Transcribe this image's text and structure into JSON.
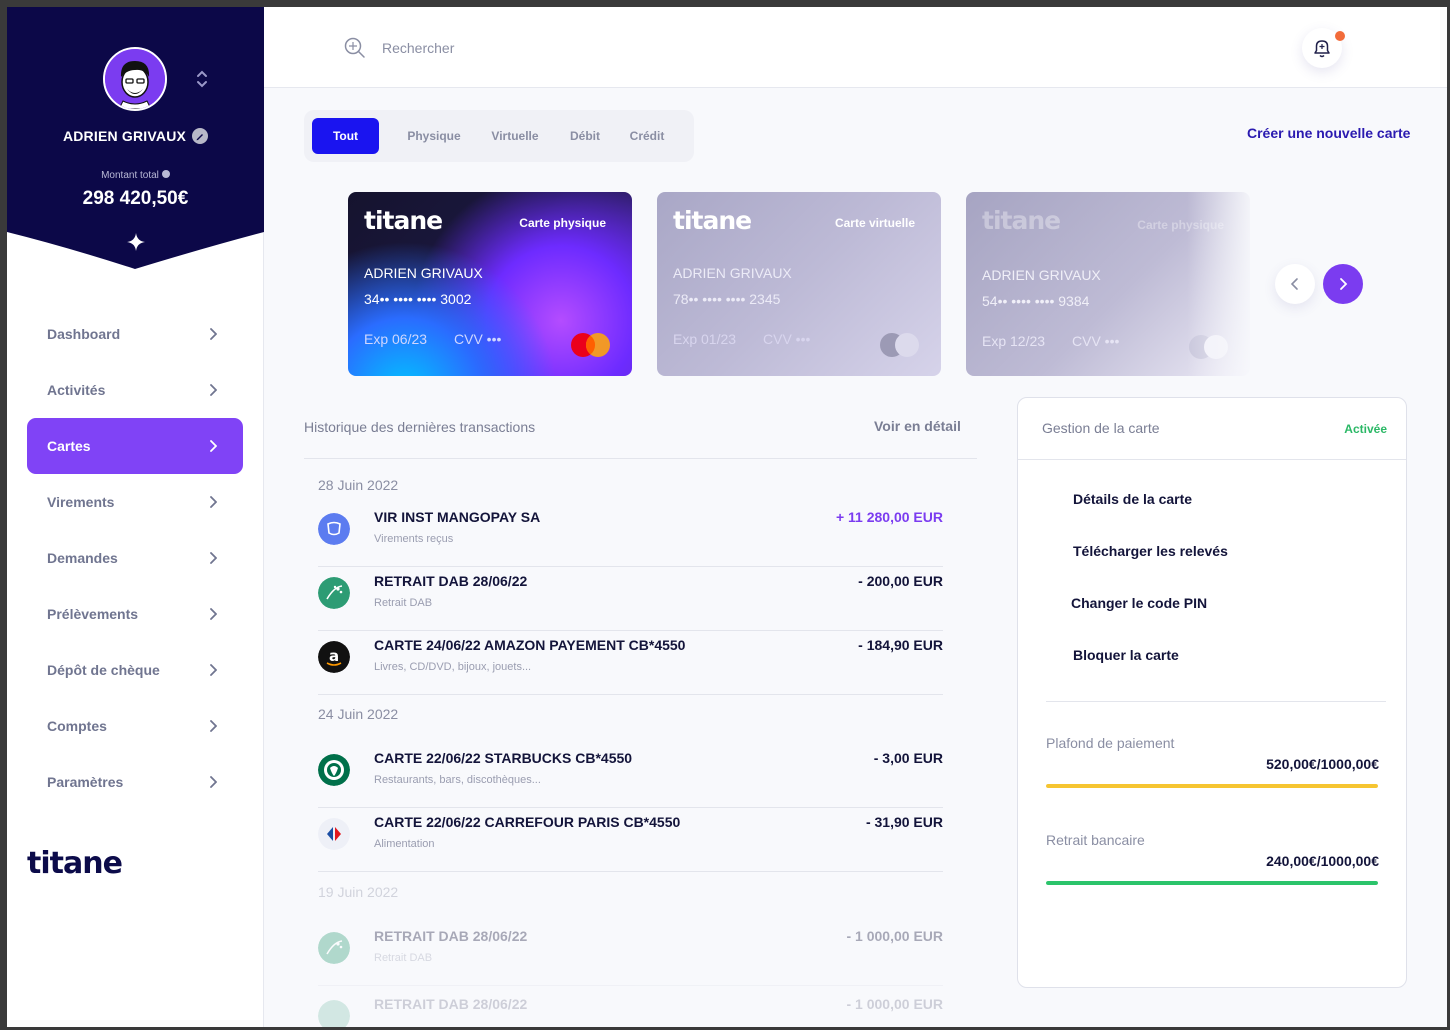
{
  "sidebar": {
    "user_name": "ADRIEN GRIVAUX",
    "total_label": "Montant total",
    "total_amount": "298 420,50€",
    "brand": "titane",
    "nav": [
      {
        "label": "Dashboard",
        "active": false
      },
      {
        "label": "Activités",
        "active": false
      },
      {
        "label": "Cartes",
        "active": true
      },
      {
        "label": "Virements",
        "active": false
      },
      {
        "label": "Demandes",
        "active": false
      },
      {
        "label": "Prélèvements",
        "active": false
      },
      {
        "label": "Dépôt de chèque",
        "active": false
      },
      {
        "label": "Comptes",
        "active": false
      },
      {
        "label": "Paramètres",
        "active": false
      }
    ],
    "colors": {
      "header_bg": "#0c0848",
      "active_bg": "#8043f6"
    }
  },
  "topbar": {
    "search_placeholder": "Rechercher",
    "notification_dot": true
  },
  "filters": {
    "tabs": [
      "Tout",
      "Physique",
      "Virtuelle",
      "Débit",
      "Crédit"
    ],
    "active": "Tout",
    "create_label": "Créer une nouvelle carte"
  },
  "cards": [
    {
      "brand": "titane",
      "type": "Carte physique",
      "holder": "ADRIEN GRIVAUX",
      "number": "34•• •••• •••• 3002",
      "exp": "Exp 06/23",
      "cvv": "CVV •••"
    },
    {
      "brand": "titane",
      "type": "Carte virtuelle",
      "holder": "ADRIEN GRIVAUX",
      "number": "78•• •••• •••• 2345",
      "exp": "Exp 01/23",
      "cvv": "CVV •••"
    },
    {
      "brand": "titane",
      "type": "Carte physique",
      "holder": "ADRIEN GRIVAUX",
      "number": "54•• •••• •••• 9384",
      "exp": "Exp 12/23",
      "cvv": "CVV •••"
    }
  ],
  "transactions": {
    "title": "Historique des dernières transactions",
    "detail_link": "Voir en détail",
    "groups": [
      {
        "date": "28 Juin 2022",
        "items": [
          {
            "name": "VIR INST MANGOPAY SA",
            "category": "Virements reçus",
            "amount": "+ 11 280,00 EUR",
            "icon": "mangopay-icon"
          },
          {
            "name": "RETRAIT DAB 28/06/22",
            "category": "Retrait DAB",
            "amount": "- 200,00 EUR",
            "icon": "bank-icon"
          },
          {
            "name": "CARTE 24/06/22 AMAZON PAYEMENT CB*4550",
            "category": "Livres, CD/DVD, bijoux, jouets...",
            "amount": "- 184,90 EUR",
            "icon": "amazon-icon"
          }
        ]
      },
      {
        "date": "24 Juin 2022",
        "items": [
          {
            "name": "CARTE  22/06/22 STARBUCKS CB*4550",
            "category": "Restaurants, bars, discothèques...",
            "amount": "- 3,00 EUR",
            "icon": "starbucks-icon"
          },
          {
            "name": "CARTE  22/06/22 CARREFOUR PARIS CB*4550",
            "category": "Alimentation",
            "amount": "- 31,90 EUR",
            "icon": "carrefour-icon"
          }
        ]
      },
      {
        "date": "19 Juin 2022",
        "items": [
          {
            "name": "RETRAIT DAB 28/06/22",
            "category": "Retrait DAB",
            "amount": "- 1 000,00 EUR",
            "icon": "bank-icon"
          },
          {
            "name": "RETRAIT DAB 28/06/22",
            "category": "",
            "amount": "- 1 000,00 EUR",
            "icon": "bank-icon"
          }
        ]
      }
    ]
  },
  "management": {
    "title": "Gestion de la carte",
    "status": "Activée",
    "actions": [
      "Détails de la carte",
      "Télécharger les relevés",
      "Changer le code PIN",
      "Bloquer la carte"
    ],
    "limits": [
      {
        "label": "Plafond de paiement",
        "value": "520,00€/1000,00€",
        "fraction": 1.0,
        "color": "#f6c531"
      },
      {
        "label": "Retrait bancaire",
        "value": "240,00€/1000,00€",
        "fraction": 1.0,
        "color": "#2bc46b"
      }
    ]
  }
}
